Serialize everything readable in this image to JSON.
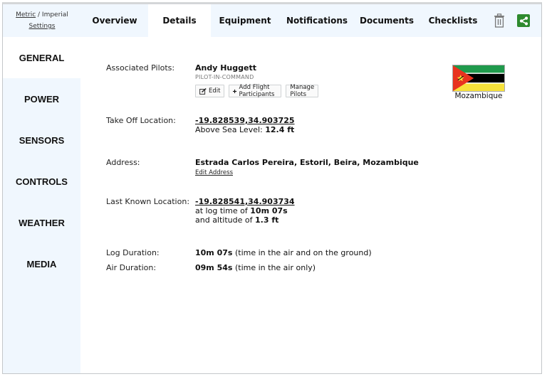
{
  "units": {
    "metric": "Metric",
    "separator": " / ",
    "imperial": "Imperial",
    "settings": "Settings"
  },
  "tabs": [
    {
      "label": "Overview",
      "active": false
    },
    {
      "label": "Details",
      "active": true
    },
    {
      "label": "Equipment",
      "active": false
    },
    {
      "label": "Notifications",
      "active": false
    },
    {
      "label": "Documents",
      "active": false
    },
    {
      "label": "Checklists",
      "active": false
    }
  ],
  "toolbar_icons": {
    "trash": "trash-icon",
    "share": "share-icon",
    "share_color": "#2e8a2e"
  },
  "sidebar": {
    "items": [
      {
        "label": "GENERAL",
        "active": true
      },
      {
        "label": "POWER",
        "active": false
      },
      {
        "label": "SENSORS",
        "active": false
      },
      {
        "label": "CONTROLS",
        "active": false
      },
      {
        "label": "WEATHER",
        "active": false
      },
      {
        "label": "MEDIA",
        "active": false
      }
    ]
  },
  "details": {
    "pilots": {
      "label": "Associated Pilots:",
      "name": "Andy Huggett",
      "role": "PILOT-IN-COMMAND",
      "buttons": {
        "edit": "Edit",
        "add_participants": "Add Flight Participants",
        "manage_pilots": "Manage Pilots"
      }
    },
    "country": {
      "name": "Mozambique",
      "flag": "mozambique-flag"
    },
    "takeoff": {
      "label": "Take Off Location:",
      "coords": "-19.828539,34.903725",
      "asl_prefix": "Above Sea Level: ",
      "asl_value": "12.4 ft"
    },
    "address": {
      "label": "Address:",
      "value": "Estrada Carlos Pereira, Estoril, Beira, Mozambique",
      "edit_link": "Edit Address"
    },
    "last_known": {
      "label": "Last Known Location:",
      "coords": "-19.828541,34.903734",
      "log_time_prefix": "at log time of ",
      "log_time": "10m 07s",
      "altitude_prefix": "and altitude of ",
      "altitude": "1.3 ft"
    },
    "log_duration": {
      "label": "Log Duration:",
      "value": "10m 07s",
      "note": " (time in the air and on the ground)"
    },
    "air_duration": {
      "label": "Air Duration:",
      "value": "09m 54s",
      "note": " (time in the air only)"
    }
  }
}
